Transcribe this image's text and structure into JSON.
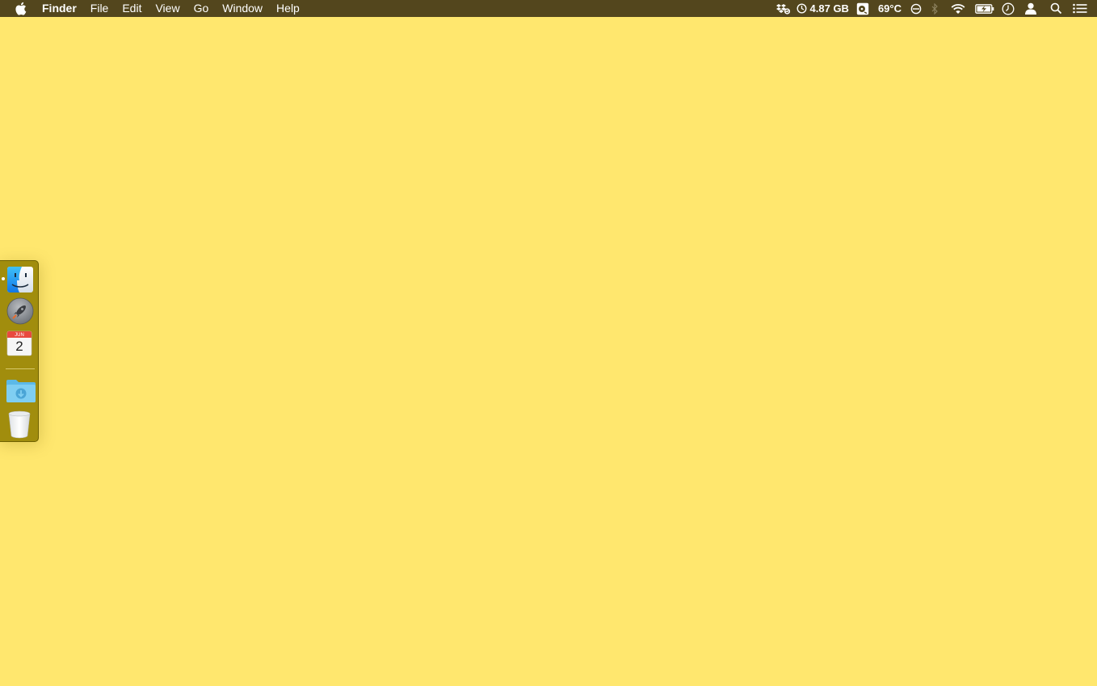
{
  "menubar": {
    "apple_icon": "apple-icon",
    "app_name": "Finder",
    "menus": [
      "File",
      "Edit",
      "View",
      "Go",
      "Window",
      "Help"
    ],
    "status": {
      "dropbox_icon": "dropbox-sync-icon",
      "memory_text": "4.87 GB",
      "disk_icon": "disk-icon",
      "temperature_text": "69°C",
      "sync_icon": "sync-icon",
      "bluetooth_icon": "bluetooth-icon",
      "wifi_icon": "wifi-icon",
      "battery_icon": "battery-charging-icon",
      "time_machine_icon": "clock-icon",
      "user_icon": "user-icon",
      "spotlight_icon": "search-icon",
      "notification_icon": "notification-center-icon"
    }
  },
  "desktop": {
    "background_color": "#ffe76e"
  },
  "dock": {
    "items": [
      {
        "name": "Finder",
        "icon": "finder-icon",
        "running": true
      },
      {
        "name": "Launchpad",
        "icon": "launchpad-icon",
        "running": false
      },
      {
        "name": "Calendar",
        "icon": "calendar-icon",
        "running": false,
        "month": "JUN",
        "day": "2"
      },
      {
        "name": "Downloads",
        "icon": "downloads-folder-icon",
        "running": false
      },
      {
        "name": "Trash",
        "icon": "trash-icon",
        "running": false
      }
    ]
  }
}
